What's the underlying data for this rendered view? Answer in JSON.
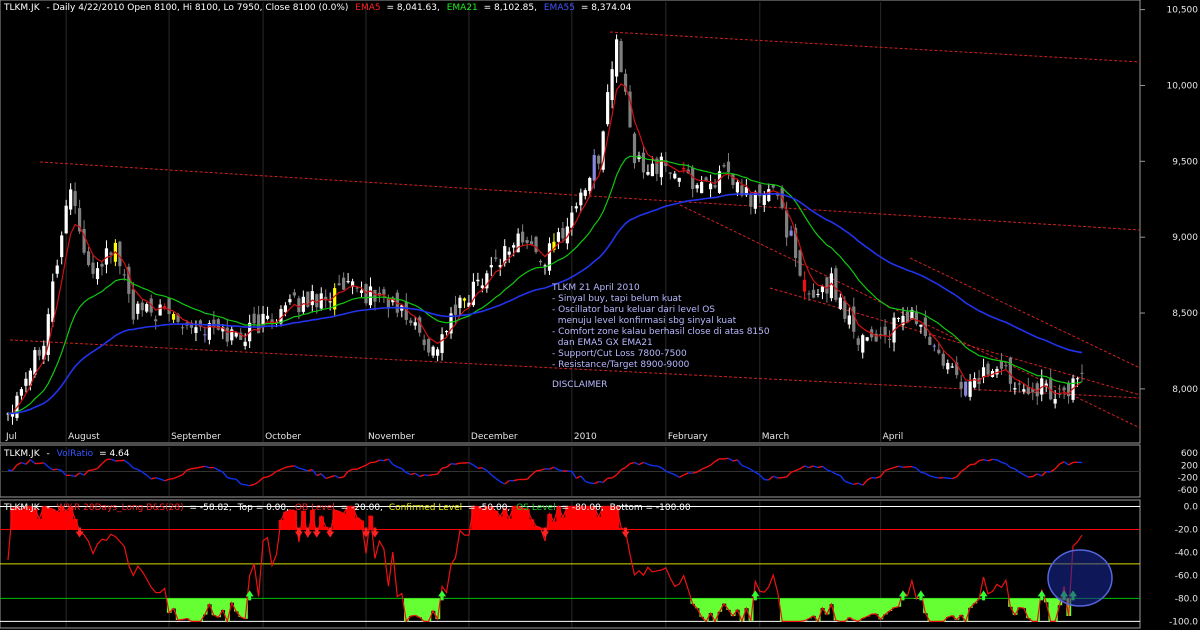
{
  "chart_data": [
    {
      "type": "candlestick",
      "panel": "price",
      "header": {
        "symbol": "TLKM.JK",
        "info": "- Daily 4/22/2010 Open 8100, Hi 8100, Lo 7950, Close 8100 (0.0%)",
        "ema5_label": "EMA5",
        "ema5_value": "= 8,041.63,",
        "ema21_label": "EMA21",
        "ema21_value": "= 8,102.85,",
        "ema55_label": "EMA55",
        "ema55_value": "= 8,374.04"
      },
      "y_ticks": [
        "10,500",
        "10,000",
        "9,500",
        "9,000",
        "8,500",
        "8,000"
      ],
      "y_tick_values": [
        10500,
        10000,
        9500,
        9000,
        8500,
        8000
      ],
      "ylim": [
        7650,
        10550
      ],
      "x_months": [
        "Jul",
        "August",
        "September",
        "October",
        "November",
        "December",
        "2010",
        "February",
        "March",
        "April"
      ],
      "annotation": [
        "TLKM 21 April 2010",
        "- Sinyal buy, tapi belum kuat",
        "- Oscillator baru keluar dari level OS",
        "  menuju level konfirmasi sbg sinyal kuat",
        "- Comfort zone kalau berhasil close di atas 8150",
        "  dan EMA5 GX EMA21",
        "- Support/Cut Loss 7800-7500",
        "- Resistance/Target 8900-9000",
        "",
        "DISCLAIMER"
      ],
      "close_anchors": [
        [
          0,
          7850
        ],
        [
          8,
          8350
        ],
        [
          14,
          9350
        ],
        [
          18,
          8750
        ],
        [
          24,
          8950
        ],
        [
          28,
          8500
        ],
        [
          36,
          8500
        ],
        [
          44,
          8400
        ],
        [
          52,
          8350
        ],
        [
          60,
          8500
        ],
        [
          68,
          8600
        ],
        [
          76,
          8650
        ],
        [
          84,
          8600
        ],
        [
          90,
          8450
        ],
        [
          95,
          8250
        ],
        [
          100,
          8500
        ],
        [
          106,
          8750
        ],
        [
          114,
          9000
        ],
        [
          120,
          8850
        ],
        [
          126,
          9150
        ],
        [
          132,
          9550
        ],
        [
          136,
          10300
        ],
        [
          140,
          9500
        ],
        [
          148,
          9450
        ],
        [
          154,
          9350
        ],
        [
          160,
          9400
        ],
        [
          166,
          9250
        ],
        [
          172,
          9300
        ],
        [
          178,
          8600
        ],
        [
          184,
          8700
        ],
        [
          190,
          8350
        ],
        [
          196,
          8350
        ],
        [
          202,
          8500
        ],
        [
          208,
          8200
        ],
        [
          214,
          8000
        ],
        [
          220,
          8150
        ],
        [
          226,
          8050
        ],
        [
          232,
          8000
        ],
        [
          236,
          7950
        ],
        [
          240,
          8100
        ]
      ],
      "ema_colors": {
        "EMA5": "#d01010",
        "EMA21": "#10c810",
        "EMA55": "#2233ee"
      },
      "candle_colors": {
        "up": "#ffffff",
        "down": "#808080",
        "highlight_yellow": "#ffff00",
        "highlight_red": "#ee1111",
        "highlight_blue": "#8888dd"
      }
    },
    {
      "type": "line",
      "panel": "volume_oscillator",
      "header": {
        "symbol": "TLKM.JK",
        "series_label": "VolRatio",
        "value": "= 4.64"
      },
      "y_ticks": [
        "600",
        "200",
        "-200",
        "-600"
      ],
      "ylim": [
        -800,
        800
      ],
      "colors": {
        "up": "#ee1111",
        "down": "#1133ee"
      }
    },
    {
      "type": "line",
      "panel": "williams_r",
      "header": {
        "symbol": "TLKM.JK",
        "series_label": "W%R 28Days_Long B&S(28)",
        "value": "= -58.82,",
        "top_text": "Top = 0.00,",
        "ob_label": "OB Level",
        "ob_value": "= -20.00,",
        "confirmed_label": "Confirmed Level",
        "confirmed_value": "= -50.00,",
        "os_label": "OS Level",
        "os_value": "= -80.00,",
        "bottom_text": "Bottom = -100.00"
      },
      "y_ticks": [
        "0.0",
        "-20.0",
        "-40.0",
        "-60.0",
        "-80.0",
        "-100.0"
      ],
      "y_tick_values": [
        0,
        -20,
        -40,
        -60,
        -80,
        -100
      ],
      "ylim": [
        -104,
        3
      ],
      "levels": {
        "top": 0,
        "ob": -20,
        "confirmed": -50,
        "os": -80,
        "bottom": -100
      },
      "colors": {
        "line": "#ee1111",
        "ob_fill": "#ff0000",
        "os_fill": "#66ff33",
        "ob_level": "#ff0000",
        "confirmed_level": "#dddd00",
        "os_level": "#00bb00",
        "circle": "#3344cc"
      }
    }
  ]
}
